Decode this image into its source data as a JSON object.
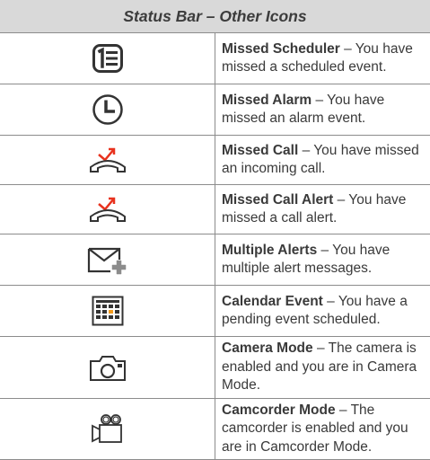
{
  "table": {
    "title": "Status Bar – Other Icons",
    "rows": [
      {
        "icon": "missed-scheduler-icon",
        "term": "Missed Scheduler",
        "sep": " – ",
        "text": "You have missed a scheduled event."
      },
      {
        "icon": "missed-alarm-icon",
        "term": "Missed Alarm",
        "sep": " – ",
        "text": "You have missed an alarm event."
      },
      {
        "icon": "missed-call-icon",
        "term": "Missed Call",
        "sep": " – ",
        "text": "You have missed an incoming call."
      },
      {
        "icon": "missed-call-alert-icon",
        "term": "Missed Call Alert",
        "sep": " – ",
        "text": "You have missed a call alert."
      },
      {
        "icon": "multiple-alerts-icon",
        "term": "Multiple Alerts",
        "sep": " – ",
        "text": "You have multiple alert messages."
      },
      {
        "icon": "calendar-event-icon",
        "term": "Calendar Event",
        "sep": " – ",
        "text": "You have a pending event scheduled."
      },
      {
        "icon": "camera-mode-icon",
        "term": "Camera Mode",
        "sep": " – ",
        "text": "The camera is enabled and you are in Camera Mode."
      },
      {
        "icon": "camcorder-mode-icon",
        "term": "Camcorder Mode",
        "sep": " – ",
        "text": "The camcorder is enabled and you are in Camcorder Mode."
      }
    ]
  },
  "colors": {
    "header_bg": "#d9d9d9",
    "border": "#8c8c8c",
    "icon_stroke": "#333333",
    "missed_red": "#e8321e",
    "accent_orange": "#f39a1b"
  }
}
